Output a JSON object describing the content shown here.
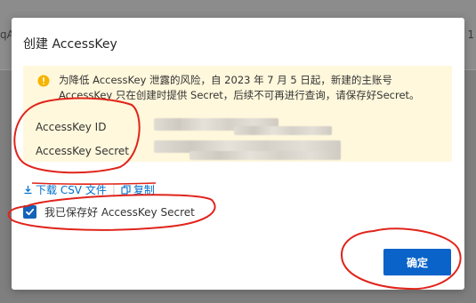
{
  "background": {
    "left_text": "qA",
    "right_text": "1"
  },
  "dialog": {
    "title": "创建 AccessKey",
    "alert": {
      "icon": "warning-circle-icon",
      "line1": "为降低 AccessKey 泄露的风险，自 2023 年 7 月 5 日起，新建的主账号",
      "line2": "AccessKey 只在创建时提供 Secret，后续不可再进行查询，请保存好Secret。"
    },
    "fields": {
      "id_label": "AccessKey ID",
      "secret_label": "AccessKey Secret"
    },
    "actions": {
      "download_label": "下载 CSV 文件",
      "download_icon": "download-icon",
      "copy_label": "复制",
      "copy_icon": "copy-icon"
    },
    "checkbox": {
      "checked": true,
      "label": "我已保存好 AccessKey Secret"
    },
    "confirm_label": "确定"
  },
  "colors": {
    "primary": "#0a63c9",
    "alert_bg": "#fff8dc",
    "warning": "#f5b400",
    "link": "#0070cc",
    "annotation_red": "#e0241b"
  }
}
